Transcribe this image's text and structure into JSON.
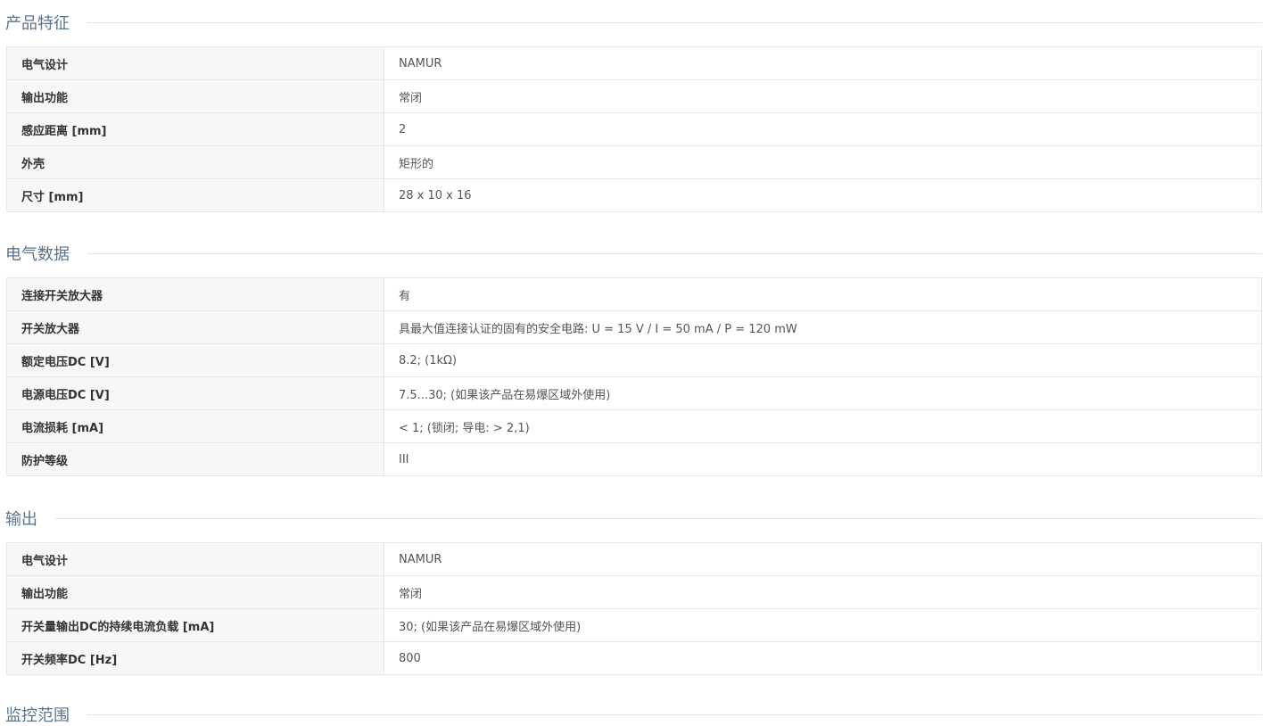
{
  "sections": [
    {
      "title": "产品特征",
      "rows": [
        {
          "label": "电气设计",
          "value": "NAMUR"
        },
        {
          "label": "输出功能",
          "value": "常闭"
        },
        {
          "label": "感应距离 [mm]",
          "value": "2"
        },
        {
          "label": "外壳",
          "value": "矩形的"
        },
        {
          "label": "尺寸 [mm]",
          "value": "28 x 10 x 16"
        }
      ]
    },
    {
      "title": "电气数据",
      "rows": [
        {
          "label": "连接开关放大器",
          "value": "有"
        },
        {
          "label": "开关放大器",
          "value": "具最大值连接认证的固有的安全电路: U = 15 V / I = 50 mA / P = 120 mW"
        },
        {
          "label": "额定电压DC [V]",
          "value": "8.2; (1kΩ)"
        },
        {
          "label": "电源电压DC [V]",
          "value": "7.5...30; (如果该产品在易爆区域外使用)"
        },
        {
          "label": "电流损耗 [mA]",
          "value": "< 1; (锁闭; 导电: > 2,1)"
        },
        {
          "label": "防护等级",
          "value": "III"
        }
      ]
    },
    {
      "title": "输出",
      "rows": [
        {
          "label": "电气设计",
          "value": "NAMUR"
        },
        {
          "label": "输出功能",
          "value": "常闭"
        },
        {
          "label": "开关量输出DC的持续电流负载 [mA]",
          "value": "30; (如果该产品在易爆区域外使用)"
        },
        {
          "label": "开关频率DC [Hz]",
          "value": "800"
        }
      ]
    },
    {
      "title": "监控范围",
      "rows": []
    }
  ]
}
